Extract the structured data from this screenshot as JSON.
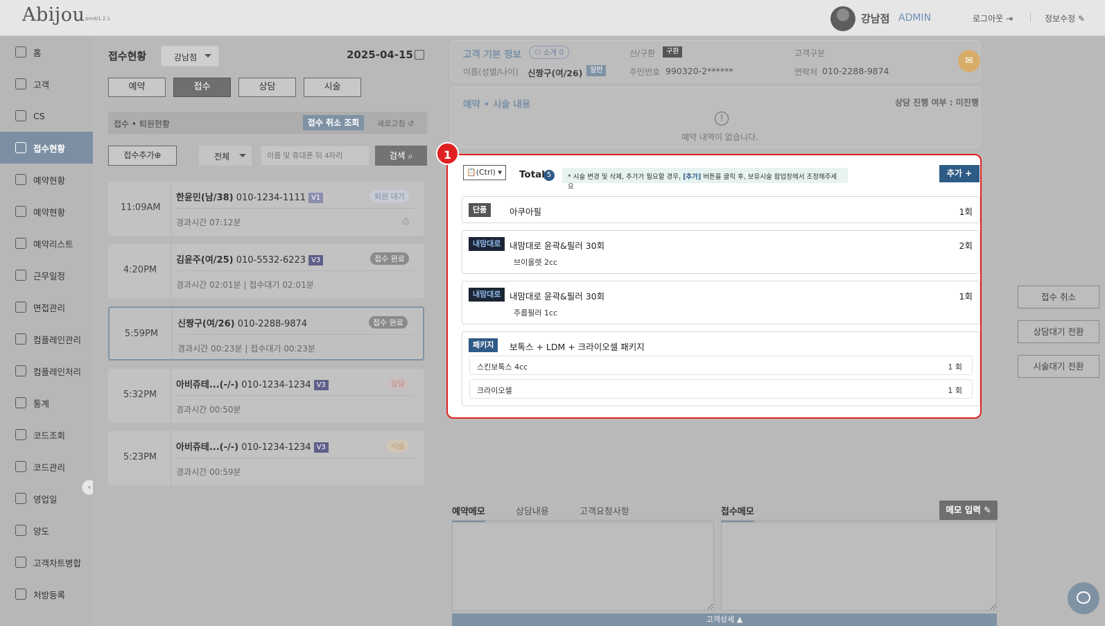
{
  "app": {
    "logo": "Abijou",
    "version": "prod/1.2.1"
  },
  "header": {
    "branch": "강남점",
    "role": "ADMIN",
    "logout": "로그아웃",
    "edit_info": "정보수정"
  },
  "sidebar": {
    "items": [
      {
        "label": "홈",
        "icon": "home-icon"
      },
      {
        "label": "고객",
        "icon": "users-icon"
      },
      {
        "label": "CS",
        "icon": "cs-icon"
      },
      {
        "label": "접수현황",
        "icon": "reception-icon",
        "active": true
      },
      {
        "label": "예약현황",
        "icon": "calendar-icon"
      },
      {
        "label": "예약현황",
        "icon": "calendar-lock-icon"
      },
      {
        "label": "예약리스트",
        "icon": "list-icon"
      },
      {
        "label": "근무일정",
        "icon": "schedule-icon"
      },
      {
        "label": "면접관리",
        "icon": "interview-icon"
      },
      {
        "label": "컴플레인관리",
        "icon": "complaint-icon"
      },
      {
        "label": "컴플레인처리",
        "icon": "smile-icon"
      },
      {
        "label": "통계",
        "icon": "chart-icon"
      },
      {
        "label": "코드조회",
        "icon": "code-icon"
      },
      {
        "label": "코드관리",
        "icon": "code-manage-icon"
      },
      {
        "label": "영업일",
        "icon": "business-day-icon"
      },
      {
        "label": "양도",
        "icon": "transfer-icon"
      },
      {
        "label": "고객차트병합",
        "icon": "merge-icon"
      },
      {
        "label": "처방등록",
        "icon": "prescription-icon"
      }
    ]
  },
  "reception": {
    "title": "접수현황",
    "branch_select": "강남점",
    "date": "2025-04-15",
    "tabs": [
      "예약",
      "접수",
      "상담",
      "시술"
    ],
    "active_tab": "접수",
    "status_label": "접수 • 퇴원현황",
    "cancel_lookup": "접수 취소 조회",
    "refresh": "새로고침",
    "add_button": "접수추가⊕",
    "filter": "전체",
    "search_placeholder": "이름 및 휴대폰 뒤 4자리",
    "search_button": "검색",
    "cards": [
      {
        "time": "11:09AM",
        "name": "한윤민(남/38)",
        "phone": "010-1234-1111",
        "ver": "V1",
        "badge": "퇴원 대기",
        "elapsed": "경과시간 07:12분"
      },
      {
        "time": "4:20PM",
        "name": "김윤주(여/25)",
        "phone": "010-5532-6223",
        "ver": "V3",
        "badge": "접수 완료",
        "elapsed": "경과시간 02:01분 | 접수대기 02:01분"
      },
      {
        "time": "5:59PM",
        "name": "신짱구(여/26)",
        "phone": "010-2288-9874",
        "ver": "",
        "badge": "접수 완료",
        "elapsed": "경과시간 00:23분 | 접수대기 00:23분"
      },
      {
        "time": "5:32PM",
        "name": "아비쥬테...(-/-)",
        "phone": "010-1234-1234",
        "ver": "V3",
        "badge": "상담",
        "elapsed": "경과시간 00:50분"
      },
      {
        "time": "5:23PM",
        "name": "아비쥬테...(-/-)",
        "phone": "010-1234-1234",
        "ver": "V3",
        "badge": "시술",
        "elapsed": "경과시간 00:59분"
      }
    ]
  },
  "customer": {
    "section_title": "고객 기본 정보",
    "intro": "소개 0",
    "new_old_label": "신/구환",
    "new_old_value": "구환",
    "type_label": "고객구분",
    "name_label": "이름(성별/나이)",
    "name_value": "신짱구(여/26)",
    "grade": "일반",
    "id_label": "주민번호",
    "id_value": "990320-2******",
    "phone_label": "연락처",
    "phone_value": "010-2288-9874"
  },
  "reservation": {
    "title": "예약 • 시술 내용",
    "consult_status": "상담 진행 여부 : 미진행",
    "empty": "예약 내역이 없습니다."
  },
  "procedures": {
    "marker": "1",
    "paste_hint": "(Ctrl)",
    "total_label": "Total",
    "total": "5",
    "notice_pre": "* 시술 변경 및 삭제, 추가가 필요할 경우, ",
    "notice_link": "[추가]",
    "notice_post": " 버튼을 클릭 후, 보유시술 팝업창에서 조정해주세요",
    "add_button": "추가 +",
    "items": [
      {
        "tag": "단품",
        "name": "아쿠아필",
        "count": "1회",
        "sub": ""
      },
      {
        "tag": "내맘대로",
        "name": "내맘대로 윤곽&필러 30회",
        "count": "2회",
        "sub": "브이올렛 2cc"
      },
      {
        "tag": "내맘대로",
        "name": "내맘대로 윤곽&필러 30회",
        "count": "1회",
        "sub": "주름필러 1cc"
      },
      {
        "tag": "패키지",
        "name": "보톡스 + LDM + 크라이오셀 패키지",
        "count": "",
        "sub_rows": [
          {
            "name": "스킨보톡스 4cc",
            "count": "1 회"
          },
          {
            "name": "크라이오셀",
            "count": "1 회"
          }
        ]
      }
    ]
  },
  "actions": {
    "cancel": "접수 취소",
    "to_consult": "상담대기 전환",
    "to_procedure": "시술대기 전환"
  },
  "memo": {
    "tabs": [
      "예약메모",
      "상담내용",
      "고객요청사항"
    ],
    "reception_memo": "접수메모",
    "input_button": "메모 입력",
    "detail_bar": "고객상세 ▲"
  }
}
